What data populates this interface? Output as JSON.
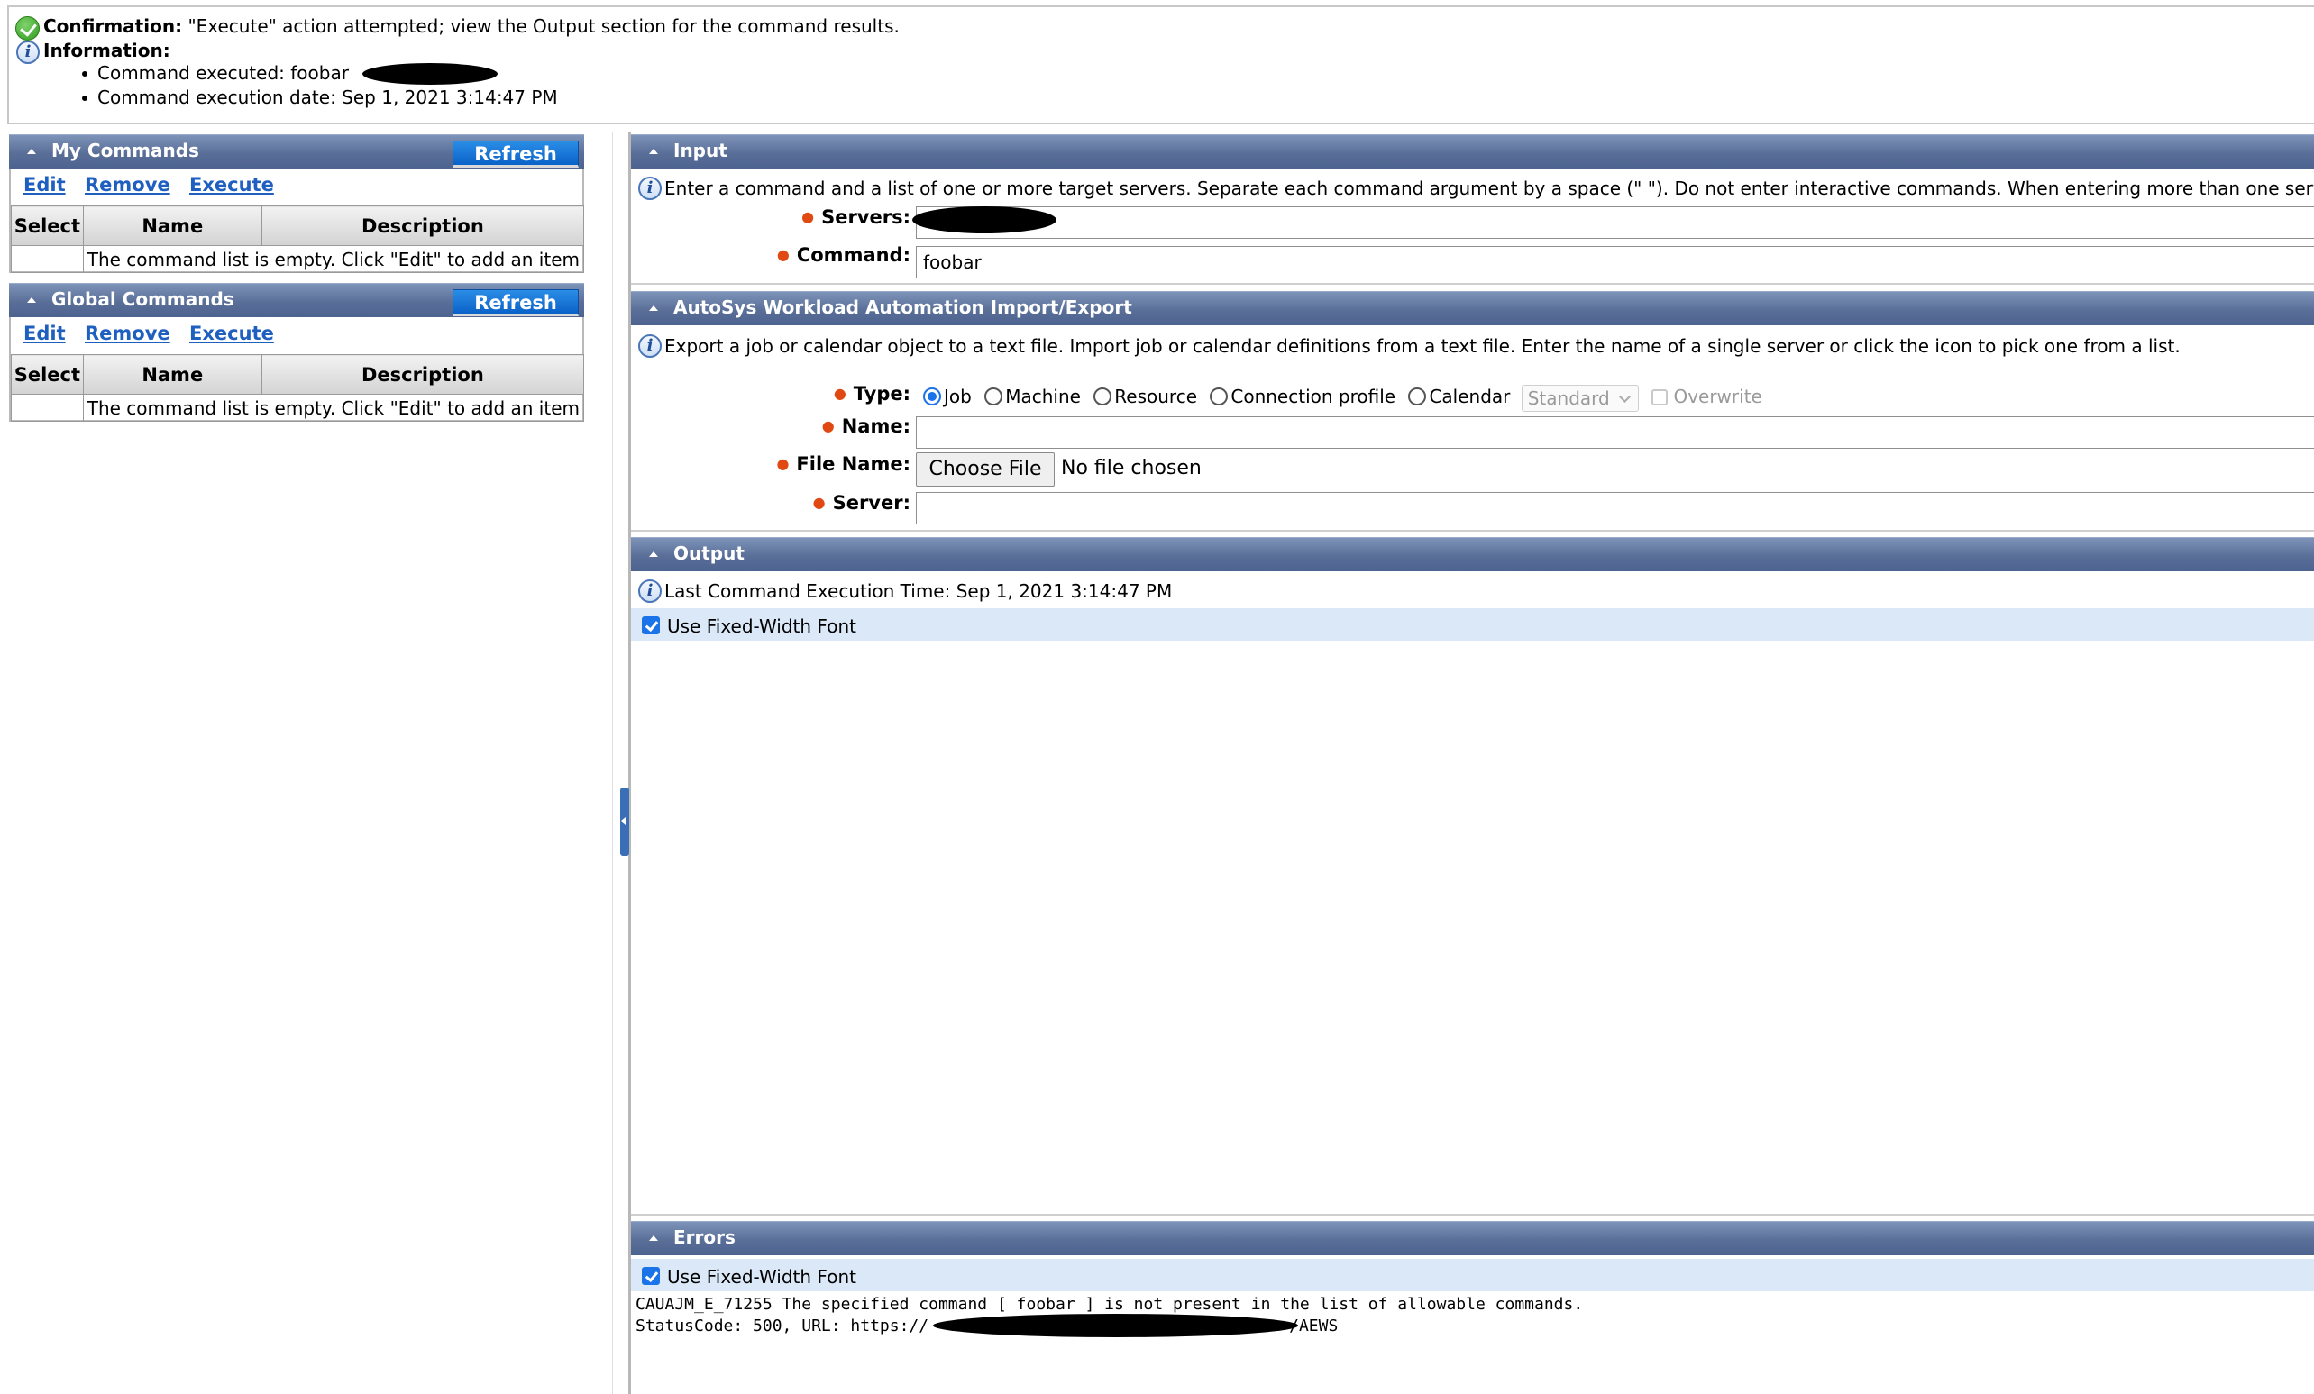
{
  "messages": {
    "confirmation_label": "Confirmation:",
    "confirmation_text": "\"Execute\" action attempted; view the Output section for the command results.",
    "information_label": "Information:",
    "info_items": [
      "Command executed: foobar",
      "Command execution date: Sep 1, 2021 3:14:47 PM"
    ]
  },
  "my_commands": {
    "title": "My Commands",
    "refresh_label": "Refresh",
    "actions": [
      "Edit",
      "Remove",
      "Execute"
    ],
    "columns": [
      "Select",
      "Name",
      "Description"
    ],
    "empty_text": "The command list is empty. Click \"Edit\" to add an item"
  },
  "global_commands": {
    "title": "Global Commands",
    "refresh_label": "Refresh",
    "actions": [
      "Edit",
      "Remove",
      "Execute"
    ],
    "columns": [
      "Select",
      "Name",
      "Description"
    ],
    "empty_text": "The command list is empty. Click \"Edit\" to add an item"
  },
  "input_section": {
    "title": "Input",
    "info_text": "Enter a command and a list of one or more target servers. Separate each command argument by a space (\" \"). Do not enter interactive commands. When entering more than one server",
    "servers_label": "Servers:",
    "servers_value": "",
    "command_label": "Command:",
    "command_value": "foobar"
  },
  "import_export": {
    "title": "AutoSys Workload Automation Import/Export",
    "info_text": "Export a job or calendar object to a text file. Import job or calendar definitions from a text file. Enter the name of a single server or click the icon to pick one from a list.",
    "type_label": "Type:",
    "type_options": [
      "Job",
      "Machine",
      "Resource",
      "Connection profile",
      "Calendar"
    ],
    "type_selected": "Job",
    "calendar_kind": "Standard",
    "overwrite_label": "Overwrite",
    "name_label": "Name:",
    "name_value": "",
    "file_name_label": "File Name:",
    "choose_file_label": "Choose File",
    "no_file_text": "No file chosen",
    "server_label": "Server:",
    "server_value": ""
  },
  "output_section": {
    "title": "Output",
    "last_exec_text": "Last Command Execution Time: Sep 1, 2021 3:14:47 PM",
    "fixed_width_label": "Use Fixed-Width Font",
    "fixed_width_checked": true
  },
  "errors_section": {
    "title": "Errors",
    "fixed_width_label": "Use Fixed-Width Font",
    "fixed_width_checked": true,
    "error_line_1": "CAUAJM_E_71255 The specified command [ foobar ] is not present in the list of allowable commands.",
    "error_line_2_prefix": "StatusCode: 500, URL: https://",
    "error_line_2_suffix": "/AEWS"
  },
  "colors": {
    "header_blue": "#596f98",
    "refresh_blue": "#0a62c8",
    "link_blue": "#1f5fbf",
    "required_orange": "#e04a12",
    "highlight_row": "#dbe8f7"
  }
}
